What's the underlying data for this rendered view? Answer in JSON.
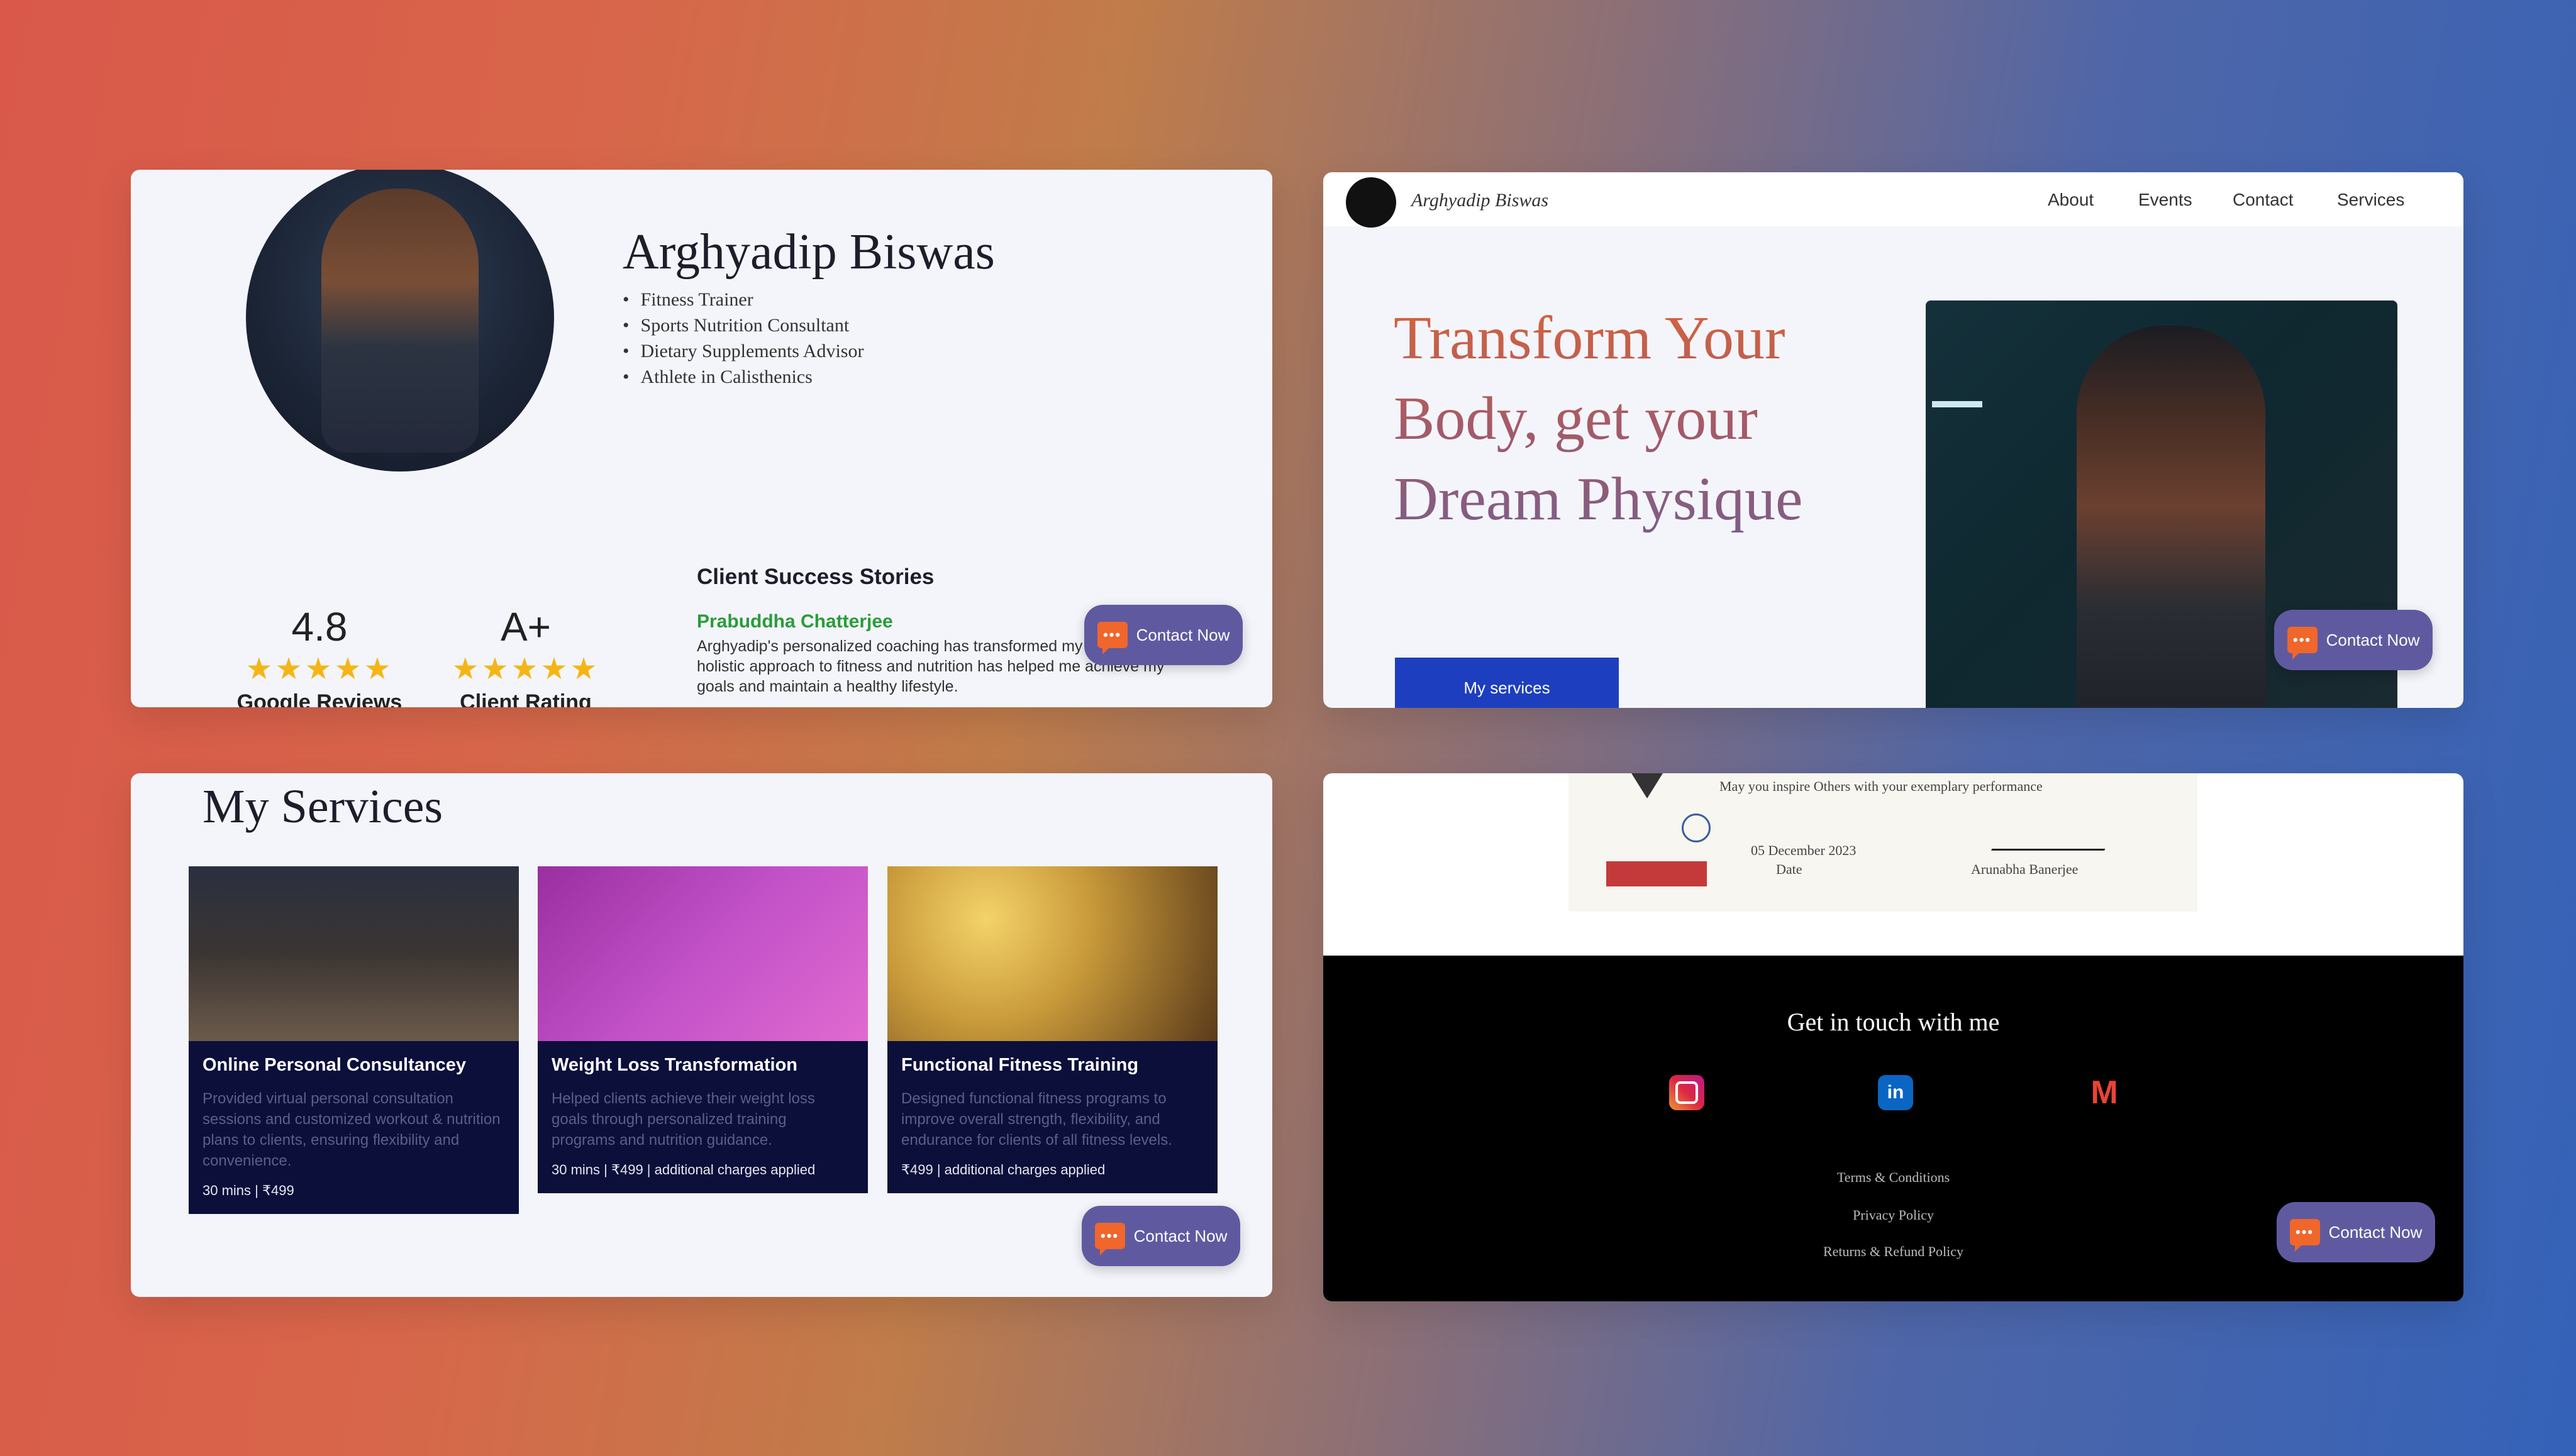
{
  "contact_button_label": "Contact Now",
  "chat_icon_glyph": "•••",
  "panel1": {
    "name": "Arghyadip Biswas",
    "roles": [
      "Fitness Trainer",
      "Sports Nutrition Consultant",
      "Dietary Supplements Advisor",
      "Athlete in Calisthenics"
    ],
    "ratings": [
      {
        "value": "4.8",
        "stars": "★★★★★",
        "label": "Google Reviews"
      },
      {
        "value": "A+",
        "stars": "★★★★★",
        "label": "Client Rating"
      }
    ],
    "stories_title": "Client Success Stories",
    "story_author": "Prabuddha Chatterjee",
    "story_text": "Arghyadip's personalized coaching has transformed my body. His holistic approach to fitness and nutrition has helped me achieve my goals and maintain a healthy lifestyle."
  },
  "panel2": {
    "brand": "Arghyadip Biswas",
    "nav": [
      "About",
      "Events",
      "Contact",
      "Services"
    ],
    "hero_title": "Transform Your Body, get your Dream Physique",
    "hero_button": "My services"
  },
  "panel3": {
    "title": "My Services",
    "services": [
      {
        "title": "Online Personal Consultancey",
        "desc": "Provided virtual personal consultation sessions and customized workout & nutrition plans to clients, ensuring flexibility and convenience.",
        "meta": "30 mins | ₹499"
      },
      {
        "title": "Weight Loss Transformation",
        "desc": "Helped clients achieve their weight loss goals through personalized training programs and nutrition guidance.",
        "meta": "30 mins | ₹499 | additional charges applied"
      },
      {
        "title": "Functional Fitness Training",
        "desc": "Designed functional fitness programs to improve overall strength, flexibility, and endurance for clients of all fitness levels.",
        "meta": "₹499 | additional charges applied"
      }
    ]
  },
  "panel4": {
    "cert_line": "May you inspire Others with your exemplary performance",
    "cert_date": "05 December 2023",
    "cert_date_label": "Date",
    "cert_signer": "Arunabha Banerjee",
    "footer_title": "Get in touch with me",
    "social": [
      {
        "name": "instagram-icon",
        "color": "#d6249f"
      },
      {
        "name": "linkedin-icon",
        "color": "#0a66c2"
      },
      {
        "name": "gmail-icon",
        "color": "#ea4335"
      }
    ],
    "links": [
      "Terms & Conditions",
      "Privacy Policy",
      "Returns & Refund Policy"
    ]
  }
}
